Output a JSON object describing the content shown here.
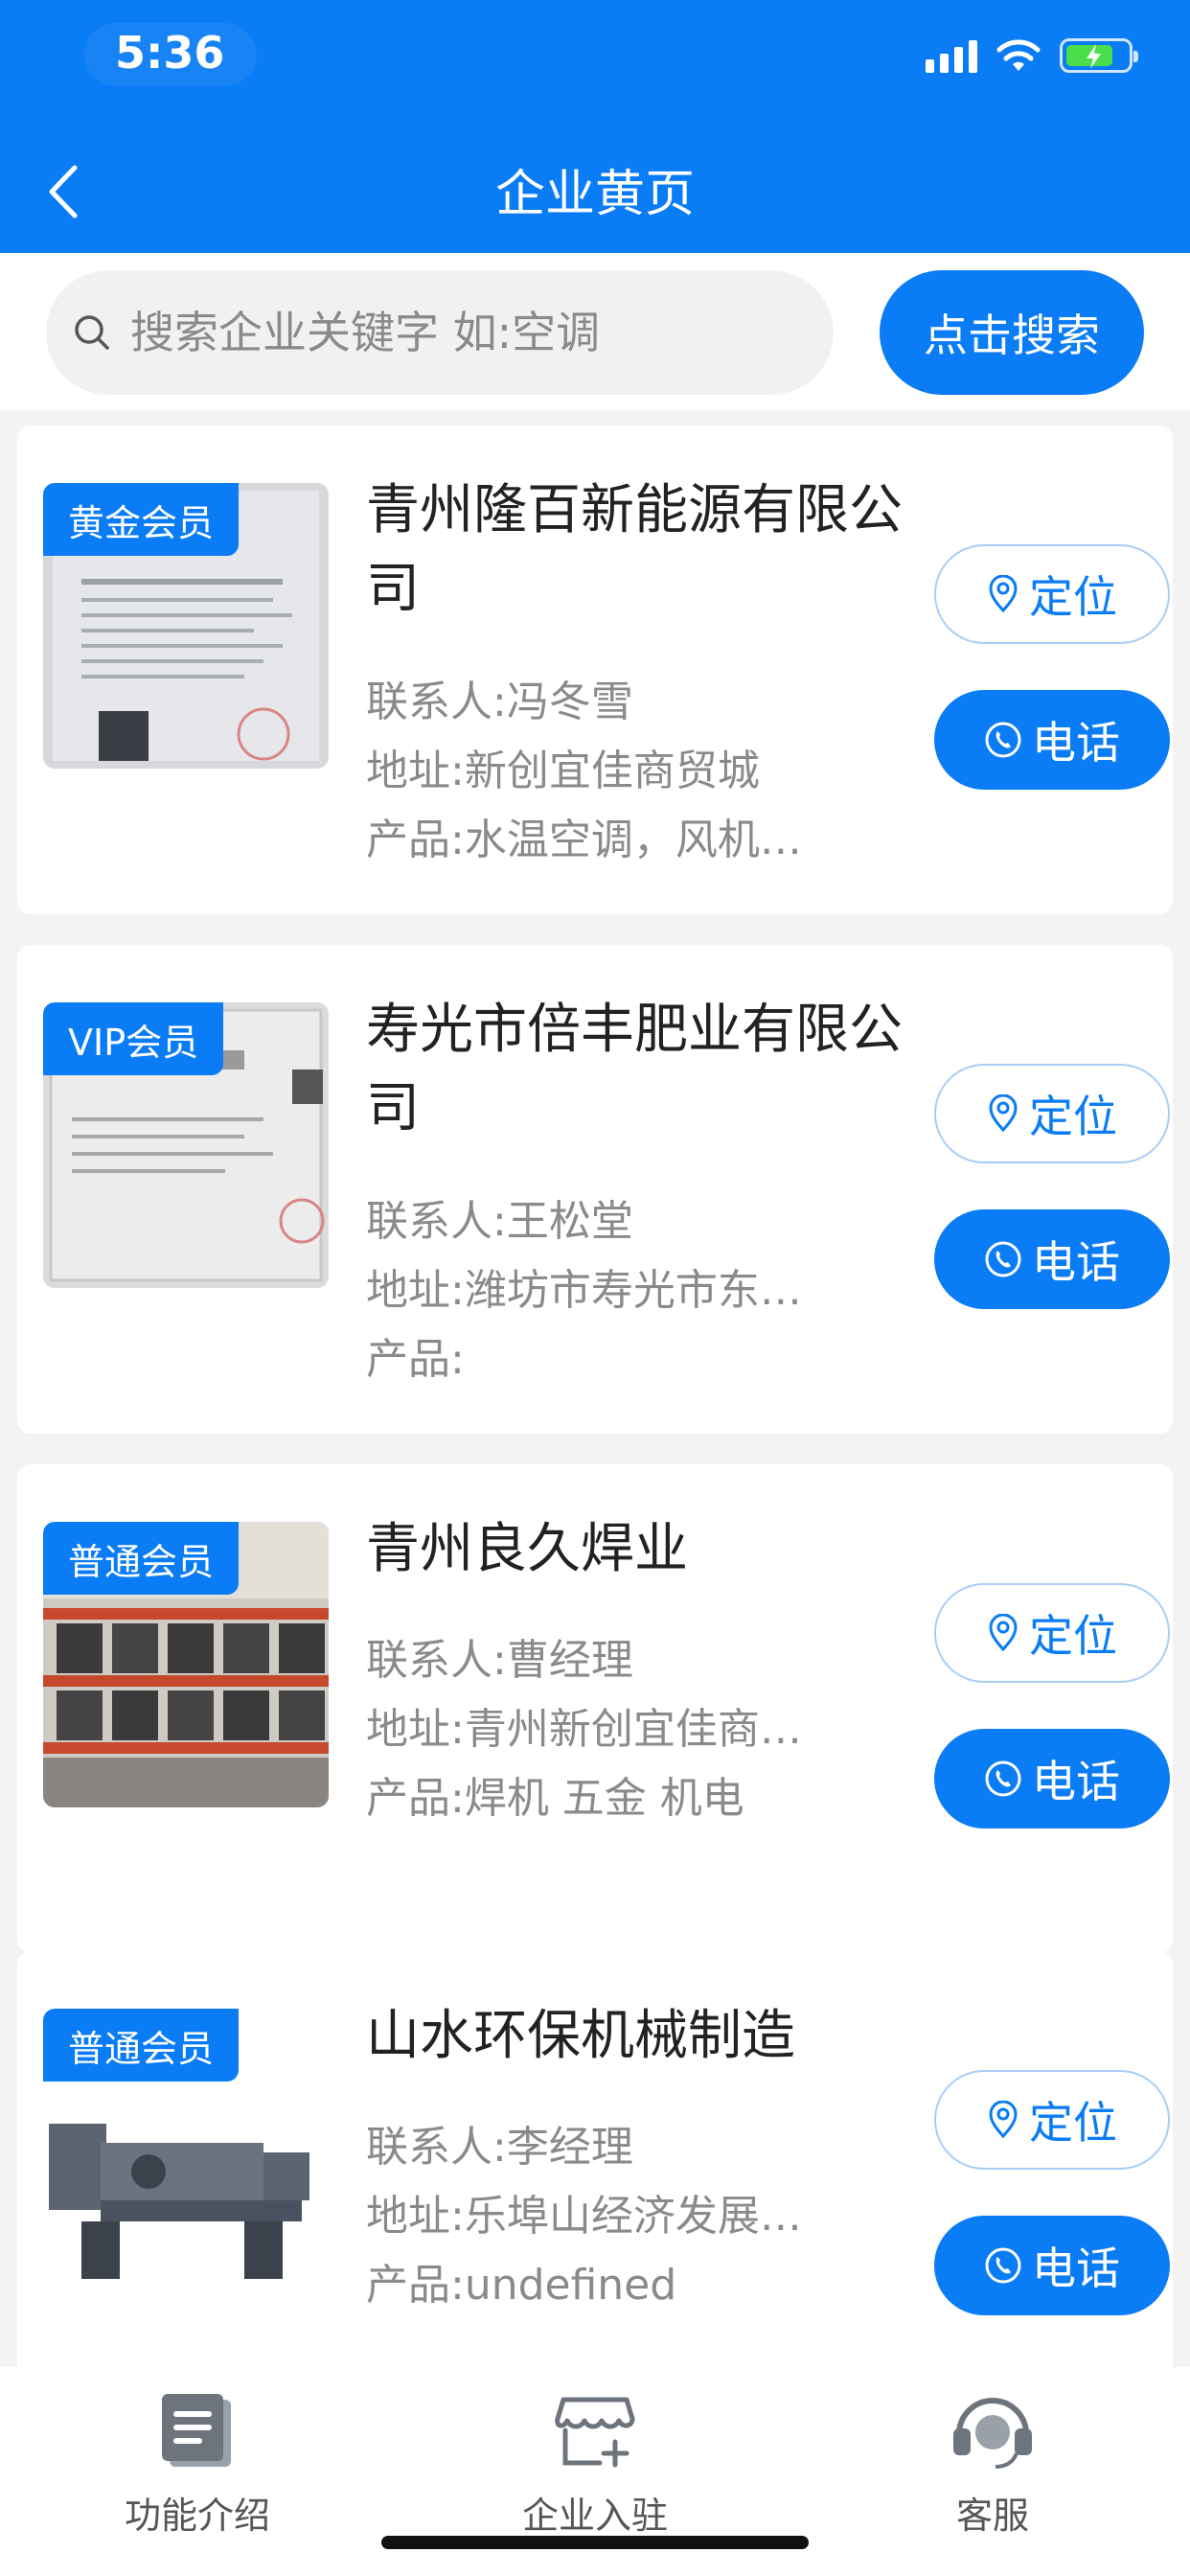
{
  "status_bar": {
    "time": "5:36"
  },
  "header": {
    "title": "企业黄页"
  },
  "search": {
    "placeholder": "搜索企业关键字 如:空调",
    "button_label": "点击搜索"
  },
  "card_actions": {
    "locate_label": "定位",
    "call_label": "电话"
  },
  "companies": [
    {
      "badge": "黄金会员",
      "name": "青州隆百新能源有限公司",
      "contact": "联系人:冯冬雪",
      "address": "地址:新创宜佳商贸城",
      "products": "产品:水温空调，风机…"
    },
    {
      "badge": "VIP会员",
      "name": "寿光市倍丰肥业有限公司",
      "contact": "联系人:王松堂",
      "address": "地址:潍坊市寿光市东…",
      "products": "产品:"
    },
    {
      "badge": "普通会员",
      "name": "青州良久焊业",
      "contact": "联系人:曹经理",
      "address": "地址:青州新创宜佳商…",
      "products": "产品:焊机 五金 机电"
    },
    {
      "badge": "普通会员",
      "name": "山水环保机械制造",
      "contact": "联系人:李经理",
      "address": "地址:乐埠山经济发展…",
      "products": "产品:undefined"
    }
  ],
  "tabbar": {
    "items": [
      {
        "label": "功能介绍",
        "icon": "document-icon"
      },
      {
        "label": "企业入驻",
        "icon": "storefront-add-icon"
      },
      {
        "label": "客服",
        "icon": "headset-icon"
      }
    ]
  },
  "colors": {
    "brand_blue": "#0a7cf5",
    "battery_green": "#4ade4a"
  }
}
